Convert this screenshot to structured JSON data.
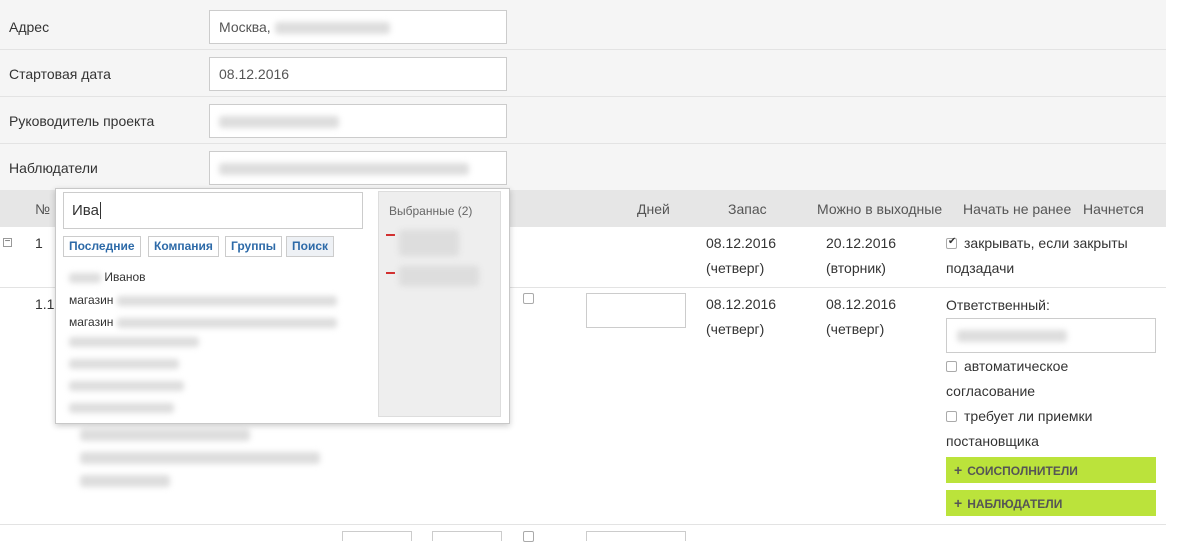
{
  "form": {
    "address_label": "Адрес",
    "address_value": "Москва,",
    "start_date_label": "Стартовая дата",
    "start_date_value": "08.12.2016",
    "manager_label": "Руководитель проекта",
    "observers_label": "Наблюдатели"
  },
  "table": {
    "headers": {
      "num": "№",
      "days": "Дней",
      "reserve": "Запас",
      "weekends": "Можно в выходные",
      "not_before": "Начать не ранее",
      "starts": "Начнется"
    },
    "row1": {
      "toggle": "−",
      "num": "1",
      "start_date": "08.12.2016",
      "start_day": "(четверг)",
      "end_date": "20.12.2016",
      "end_day": "(вторник)",
      "close_label_1": "закрывать, если закрыты",
      "close_label_2": "подзадачи",
      "close_checked": true
    },
    "row2": {
      "num": "1.1",
      "start_date": "08.12.2016",
      "start_day": "(четверг)",
      "end_date": "08.12.2016",
      "end_day": "(четверг)",
      "responsible_label": "Ответственный:",
      "auto_approval_1": "автоматическое",
      "auto_approval_2": "согласование",
      "requires_accept_1": "требует ли приемки",
      "requires_accept_2": "постановщика",
      "coexecutors_button": "СОИСПОЛНИТЕЛИ",
      "observers_button": "НАБЛЮДАТЕЛИ"
    }
  },
  "popup": {
    "search_value": "Ива",
    "tabs": [
      "Последние",
      "Компания",
      "Группы",
      "Поиск"
    ],
    "active_tab": "Поиск",
    "results": [
      "Иванов",
      "магазин",
      "магазин"
    ],
    "selected_title": "Выбранные (2)"
  },
  "colors": {
    "accent_green": "#bbe33b",
    "link_blue": "#2d6aa8",
    "remove_red": "#d23030"
  }
}
